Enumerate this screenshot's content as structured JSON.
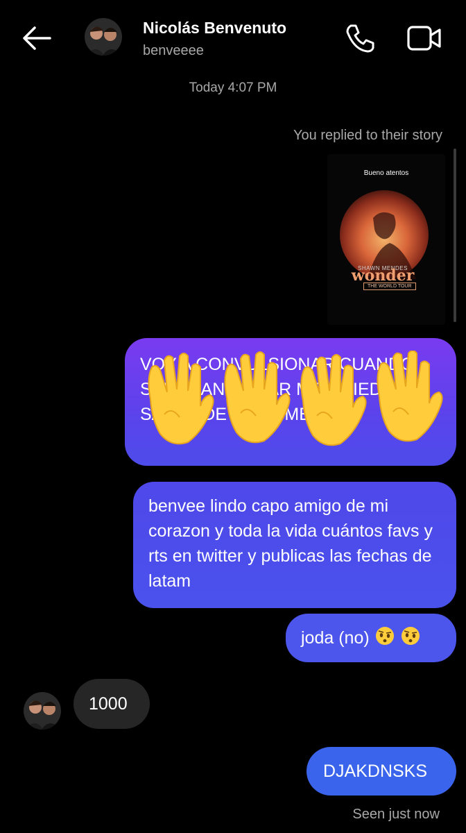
{
  "header": {
    "name": "Nicolás Benvenuto",
    "handle": "benveeee",
    "back_icon": "arrow-left-icon",
    "call_icon": "phone-icon",
    "video_icon": "video-camera-icon"
  },
  "conversation": {
    "timestamp": "Today 4:07 PM",
    "story_reply_note": "You replied to their story",
    "story": {
      "caption": "Bueno atentos",
      "artist": "SHAWN MENDES",
      "title": "wonder",
      "subtitle": "THE WORLD TOUR"
    },
    "messages": [
      {
        "from": "me",
        "text": "VOY A CONVULSIONAR CUANDO SALGA ANUNCIAR ME QUIEDO SALUD DE HACE MESES",
        "emoji": "clapping-hands-icon x4"
      },
      {
        "from": "me",
        "text": "benvee lindo capo amigo de mi corazon y toda la vida cuántos favs y rts en twitter y publicas las fechas de latam"
      },
      {
        "from": "me",
        "text": "joda (no)"
      },
      {
        "from": "them",
        "text": "1000"
      },
      {
        "from": "me",
        "text": "DJAKDNSKS"
      }
    ],
    "seen": "Seen just now"
  },
  "colors": {
    "background": "#000000",
    "bubble_purple": "#7a3bf0",
    "bubble_blue": "#3a64ec",
    "bubble_received": "#262626",
    "muted_text": "#a8a8a8"
  }
}
